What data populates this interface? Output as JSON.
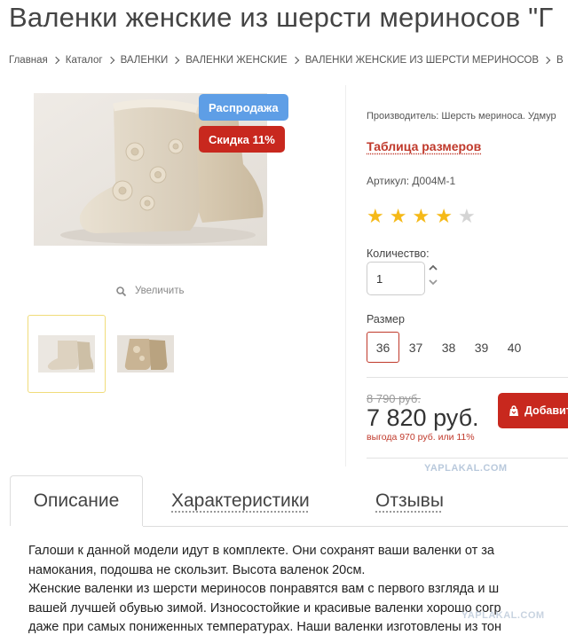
{
  "title": "Валенки женские из шерсти мериносов \"Г",
  "breadcrumb": [
    "Главная",
    "Каталог",
    "ВАЛЕНКИ",
    "ВАЛЕНКИ ЖЕНСКИЕ",
    "ВАЛЕНКИ ЖЕНСКИЕ ИЗ ШЕРСТИ МЕРИНОСОВ",
    "В"
  ],
  "gallery": {
    "badges": {
      "sale": "Распродажа",
      "discount": "Скидка 11%"
    },
    "zoom_label": "Увеличить"
  },
  "product": {
    "manufacturer": "Производитель: Шерсть мериноса. Удмур",
    "size_table_link": "Таблица размеров",
    "article": "Артикул: Д004М-1",
    "rating": 4,
    "rating_max": 5,
    "quantity_label": "Количество:",
    "quantity_value": "1",
    "size_label": "Размер",
    "sizes": [
      "36",
      "37",
      "38",
      "39",
      "40"
    ],
    "selected_size": "36",
    "old_price": "8 790 руб.",
    "price": "7 820 руб.",
    "saving": "выгода 970 руб. или 11%",
    "add_to_cart": "Добавит"
  },
  "tabs": [
    "Описание",
    "Характеристики",
    "Отзывы"
  ],
  "description_lines": [
    "Галоши к данной модели идут в комплекте. Они сохранят ваши валенки от за",
    "намокания, подошва не скользит. Высота валенок 20см.",
    "Женские валенки из шерсти мериносов понравятся вам с первого взгляда и ш",
    "вашей лучшей обувью зимой. Износостойкие и красивые валенки хорошо согр",
    "даже при самых пониженных температурах. Наши валенки изготовлены из тон"
  ],
  "watermark": "YAPLAKAL.COM",
  "colors": {
    "accent_red": "#c8281e",
    "sale_blue": "#5e9ee6",
    "star": "#f5b918"
  }
}
